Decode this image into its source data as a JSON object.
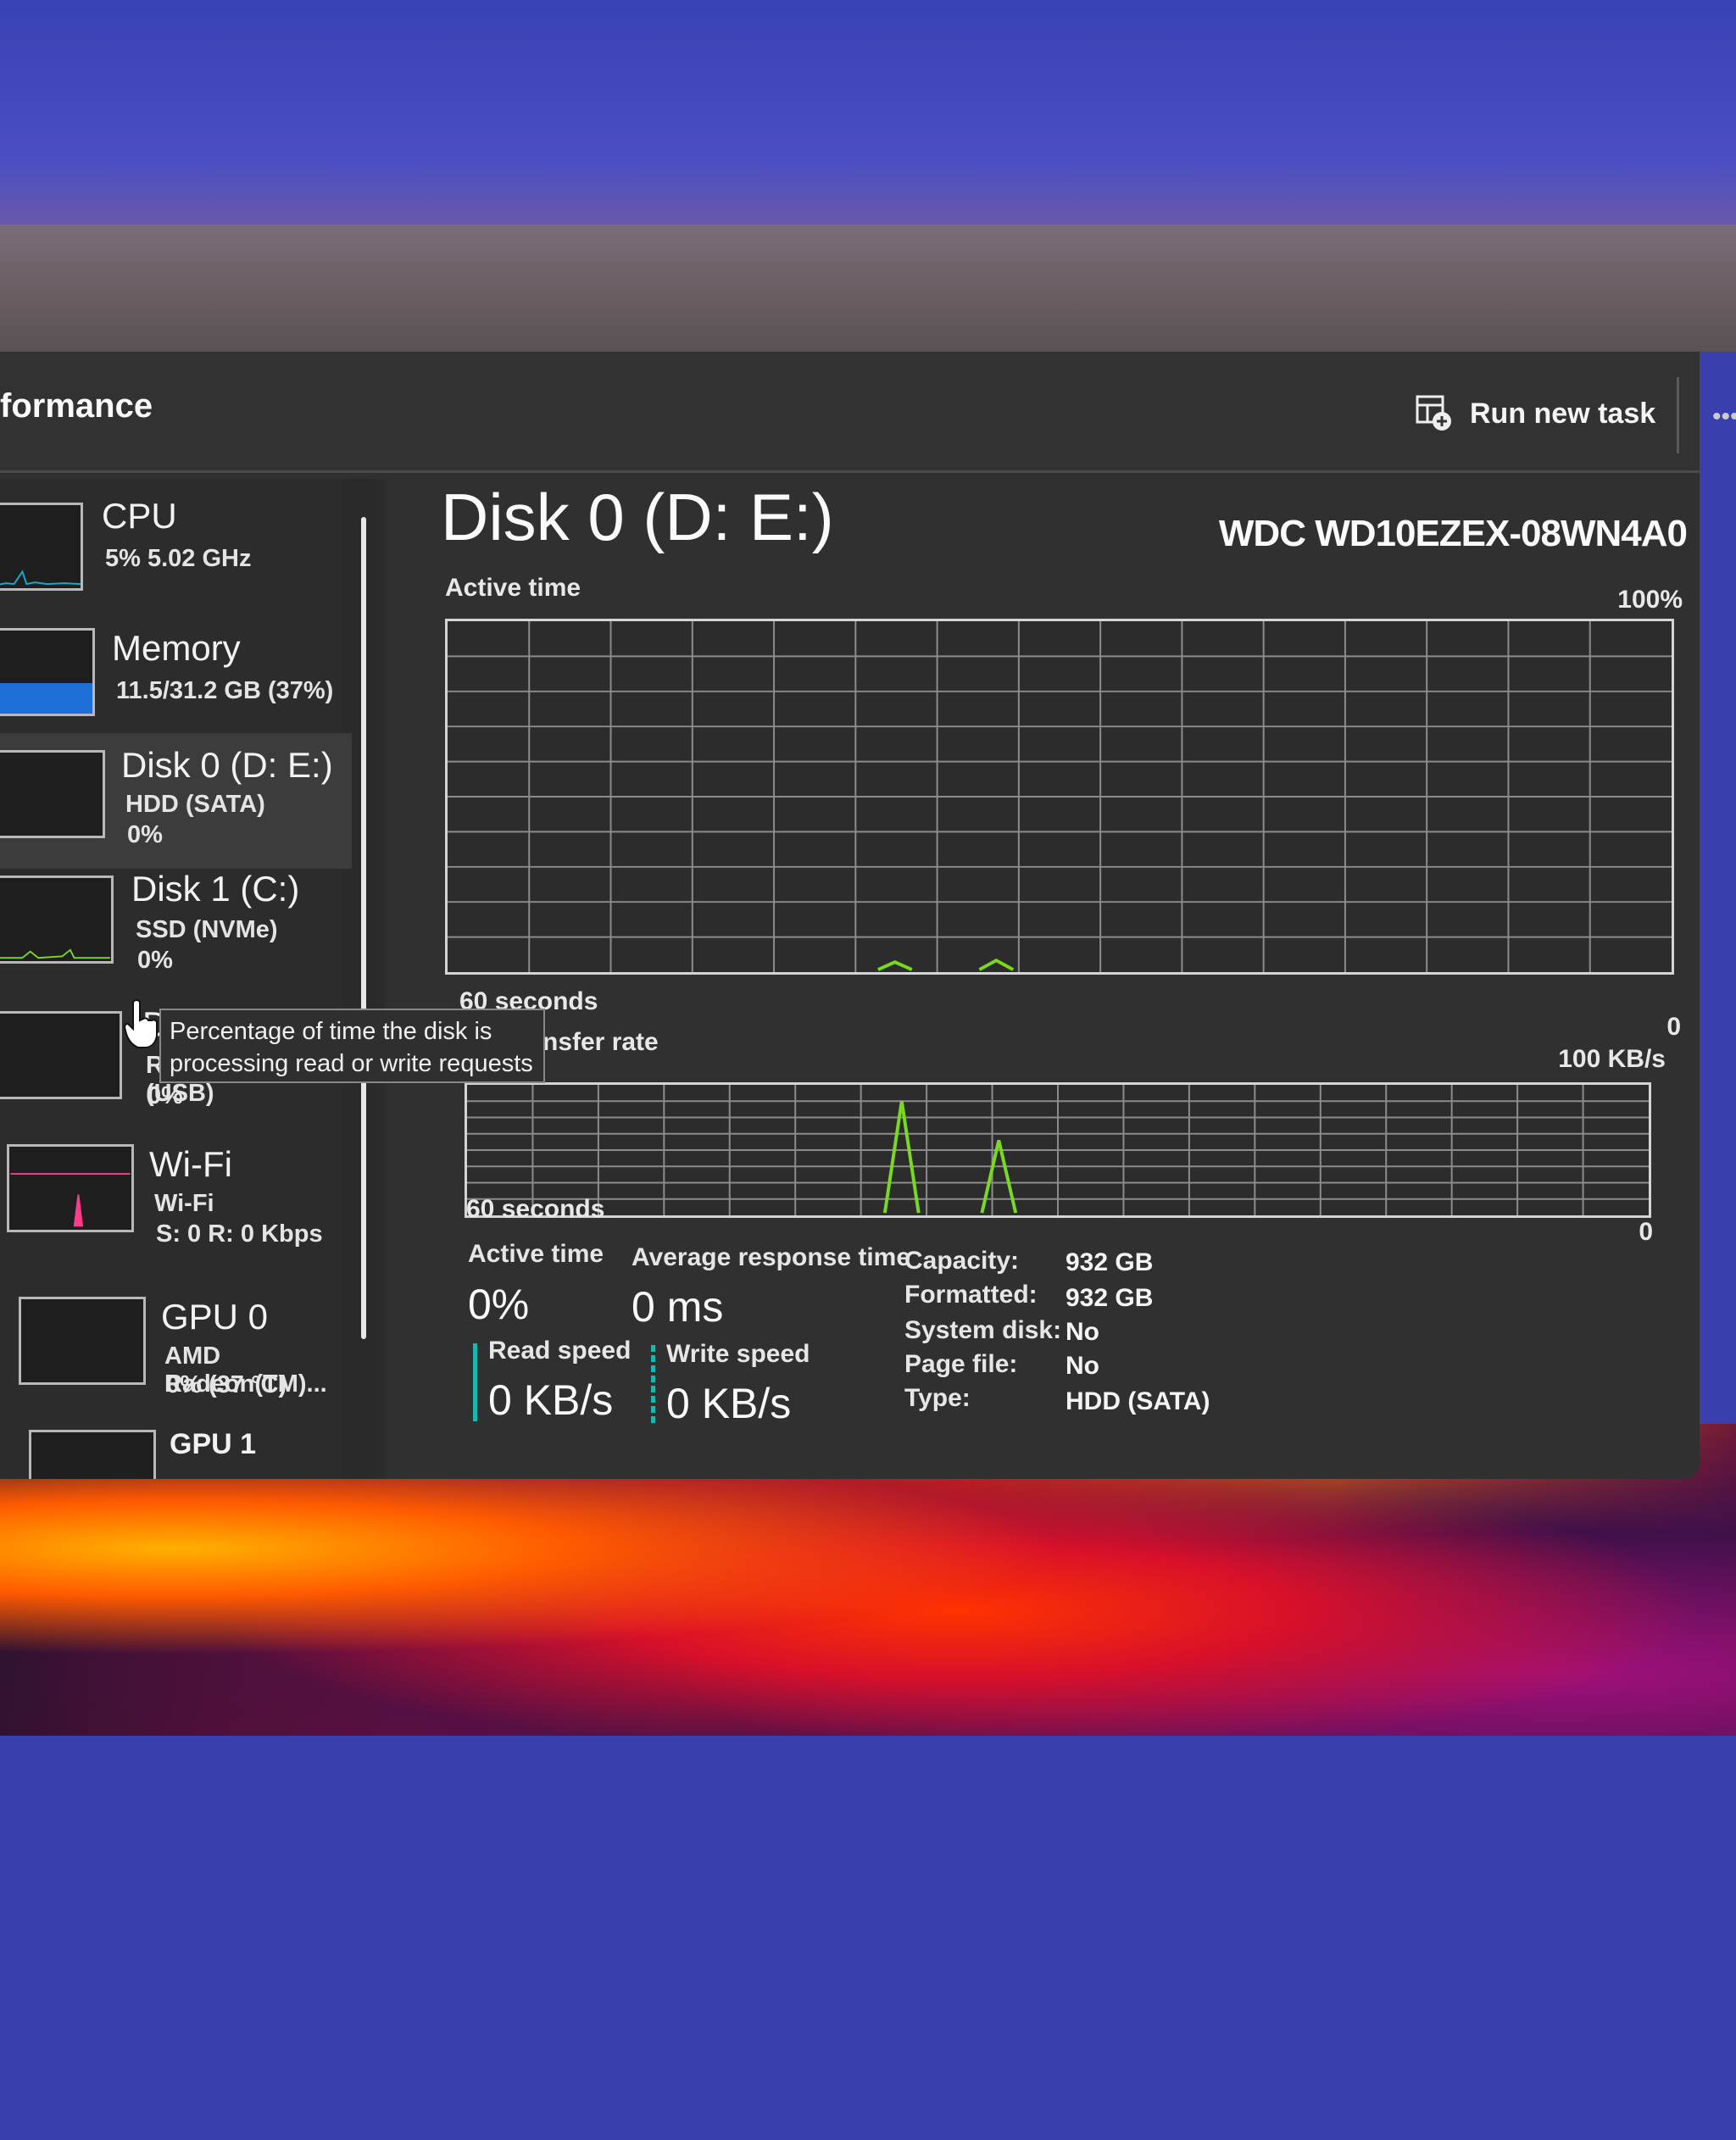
{
  "window": {
    "page_title": "formance",
    "run_new_task_label": "Run new task",
    "more_label": "•••"
  },
  "sidebar": {
    "items": [
      {
        "title": "CPU",
        "line1": "5%  5.02 GHz",
        "line2": ""
      },
      {
        "title": "Memory",
        "line1": "11.5/31.2 GB (37%)",
        "line2": ""
      },
      {
        "title": "Disk 0 (D: E:)",
        "line1": "HDD (SATA)",
        "line2": "0%"
      },
      {
        "title": "Disk 1 (C:)",
        "line1": "SSD (NVMe)",
        "line2": "0%"
      },
      {
        "title": "D",
        "line1": "Removable (USB)",
        "line2": "0%"
      },
      {
        "title": "Wi-Fi",
        "line1": "Wi-Fi",
        "line2": "S: 0 R: 0 Kbps"
      },
      {
        "title": "GPU 0",
        "line1": "AMD Radeon(TM)...",
        "line2": "0% (37 °C)"
      },
      {
        "title": "GPU 1",
        "line1": "",
        "line2": ""
      }
    ],
    "selected_index": 2
  },
  "tooltip": {
    "line1": "Percentage of time the disk is",
    "line2": "processing read or write requests"
  },
  "detail": {
    "title": "Disk 0 (D: E:)",
    "model": "WDC WD10EZEX-08WN4A0",
    "active_graph": {
      "label": "Active time",
      "max_label": "100%",
      "time_label": "60 seconds",
      "min_label": "0"
    },
    "transfer_graph": {
      "label": "nsfer rate",
      "max_label": "100 KB/s",
      "time_label": "60 seconds",
      "min_label": "0"
    },
    "stats": {
      "active_time_label": "Active time",
      "active_time_value": "0%",
      "avg_response_label": "Average response time",
      "avg_response_value": "0 ms",
      "read_speed_label": "Read speed",
      "read_speed_value": "0 KB/s",
      "write_speed_label": "Write speed",
      "write_speed_value": "0 KB/s"
    },
    "info": [
      {
        "key": "Capacity:",
        "value": "932 GB"
      },
      {
        "key": "Formatted:",
        "value": "932 GB"
      },
      {
        "key": "System disk:",
        "value": "No"
      },
      {
        "key": "Page file:",
        "value": "No"
      },
      {
        "key": "Type:",
        "value": "HDD (SATA)"
      }
    ]
  },
  "colors": {
    "graph_line": "#7ad81e",
    "memory_fill": "#1e6fd8",
    "cpu_line": "#18a8c8",
    "wifi_line": "#ff3c8c",
    "speed_accent": "#15b8b0"
  },
  "icons": [
    "minimize-icon",
    "maximize-icon",
    "run-task-icon",
    "cursor-icon"
  ]
}
